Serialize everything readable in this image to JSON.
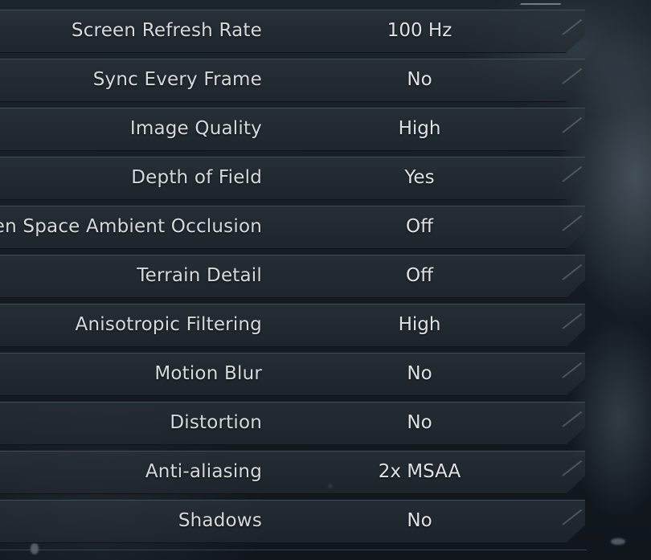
{
  "settings": [
    {
      "label": "Screen Refresh Rate",
      "value": "100 Hz"
    },
    {
      "label": "Sync Every Frame",
      "value": "No"
    },
    {
      "label": "Image Quality",
      "value": "High"
    },
    {
      "label": "Depth of Field",
      "value": "Yes"
    },
    {
      "label": "Screen Space Ambient Occlusion",
      "value": "Off"
    },
    {
      "label": "Terrain Detail",
      "value": "Off"
    },
    {
      "label": "Anisotropic Filtering",
      "value": "High"
    },
    {
      "label": "Motion Blur",
      "value": "No"
    },
    {
      "label": "Distortion",
      "value": "No"
    },
    {
      "label": "Anti-aliasing",
      "value": "2x MSAA"
    },
    {
      "label": "Shadows",
      "value": "No"
    }
  ]
}
